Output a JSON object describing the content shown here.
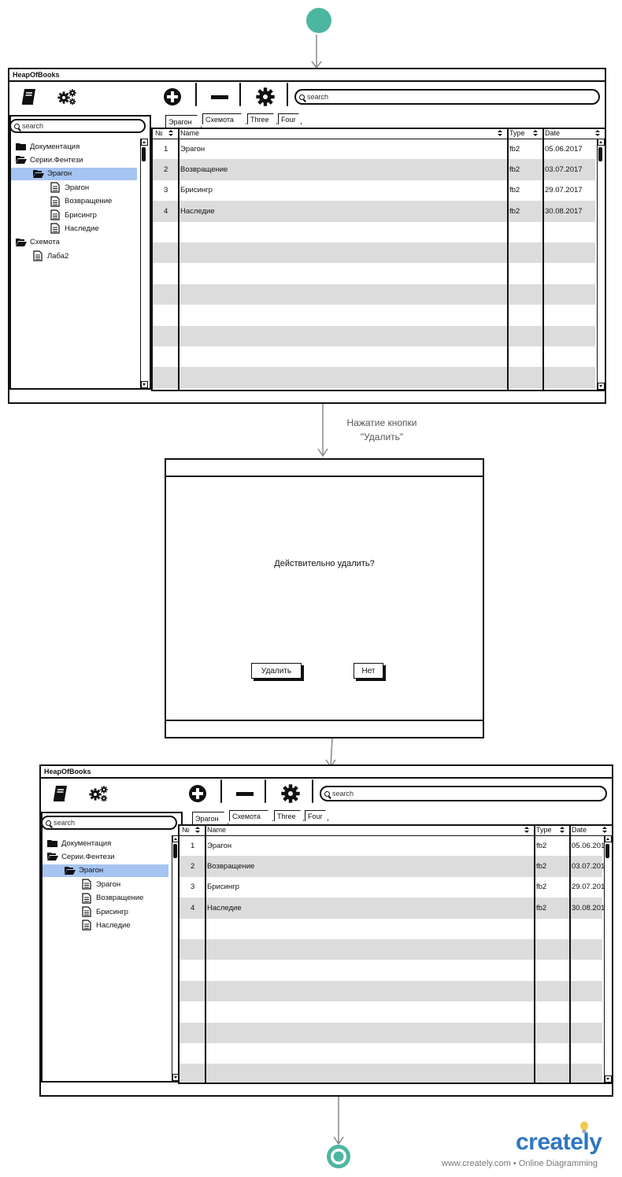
{
  "flow": {
    "edge_label_line1": "Нажатие кнопки",
    "edge_label_line2": "\"Удалить\""
  },
  "app": {
    "title": "HeapOfBooks",
    "search_placeholder": "search",
    "tree_search_placeholder": "search"
  },
  "tabs": [
    "Эрагон",
    "Схемота",
    "Three",
    "Four"
  ],
  "table": {
    "headers": [
      "№",
      "Name",
      "Type",
      "Date"
    ],
    "rows": [
      {
        "n": "1",
        "name": "Эрагон",
        "type": "fb2",
        "date": "05.06.2017"
      },
      {
        "n": "2",
        "name": "Возвращение",
        "type": "fb2",
        "date": "03.07.2017"
      },
      {
        "n": "3",
        "name": "Брисингр",
        "type": "fb2",
        "date": "29.07.2017"
      },
      {
        "n": "4",
        "name": "Наследие",
        "type": "fb2",
        "date": "30.08.2017"
      }
    ]
  },
  "tree_before": [
    {
      "label": "Документация",
      "kind": "folder-closed",
      "level": 0
    },
    {
      "label": "Серии.Фентези",
      "kind": "folder-open",
      "level": 0
    },
    {
      "label": "Эрагон",
      "kind": "folder-open",
      "level": 1,
      "selected": true
    },
    {
      "label": "Эрагон",
      "kind": "doc",
      "level": 2
    },
    {
      "label": "Возвращение",
      "kind": "doc",
      "level": 2
    },
    {
      "label": "Брисингр",
      "kind": "doc",
      "level": 2
    },
    {
      "label": "Наследие",
      "kind": "doc",
      "level": 2
    },
    {
      "label": "Схемота",
      "kind": "folder-open",
      "level": 0
    },
    {
      "label": "Лаба2",
      "kind": "doc",
      "level": 1
    }
  ],
  "tree_after": [
    {
      "label": "Документация",
      "kind": "folder-closed",
      "level": 0
    },
    {
      "label": "Серии.Фентези",
      "kind": "folder-open",
      "level": 0
    },
    {
      "label": "Эрагон",
      "kind": "folder-open",
      "level": 1,
      "selected": true
    },
    {
      "label": "Эрагон",
      "kind": "doc",
      "level": 2
    },
    {
      "label": "Возвращение",
      "kind": "doc",
      "level": 2
    },
    {
      "label": "Брисингр",
      "kind": "doc",
      "level": 2
    },
    {
      "label": "Наследие",
      "kind": "doc",
      "level": 2
    }
  ],
  "dialog": {
    "message": "Действительно удалить?",
    "confirm_label": "Удалить",
    "cancel_label": "Нет"
  },
  "branding": {
    "logo": "creately",
    "tagline": "www.creately.com • Online Diagramming",
    "accent_color": "#4db6a0",
    "logo_color": "#2f77c0"
  }
}
